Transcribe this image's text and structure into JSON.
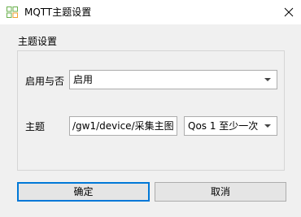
{
  "window": {
    "title": "MQTT主题设置",
    "app_icon": "grid-logo-icon",
    "close_icon": "close-icon"
  },
  "group": {
    "title": "主题设置"
  },
  "enable": {
    "label": "启用与否",
    "value": "启用"
  },
  "topic": {
    "label": "主题",
    "value": "/gw1/device/采集主图",
    "qos_value": "Qos 1 至少一次"
  },
  "buttons": {
    "ok_label": "确定",
    "cancel_label": "取消"
  },
  "colors": {
    "icon_green": "#6ab04c",
    "icon_orange": "#f0a030",
    "focus_blue": "#0078d7"
  }
}
